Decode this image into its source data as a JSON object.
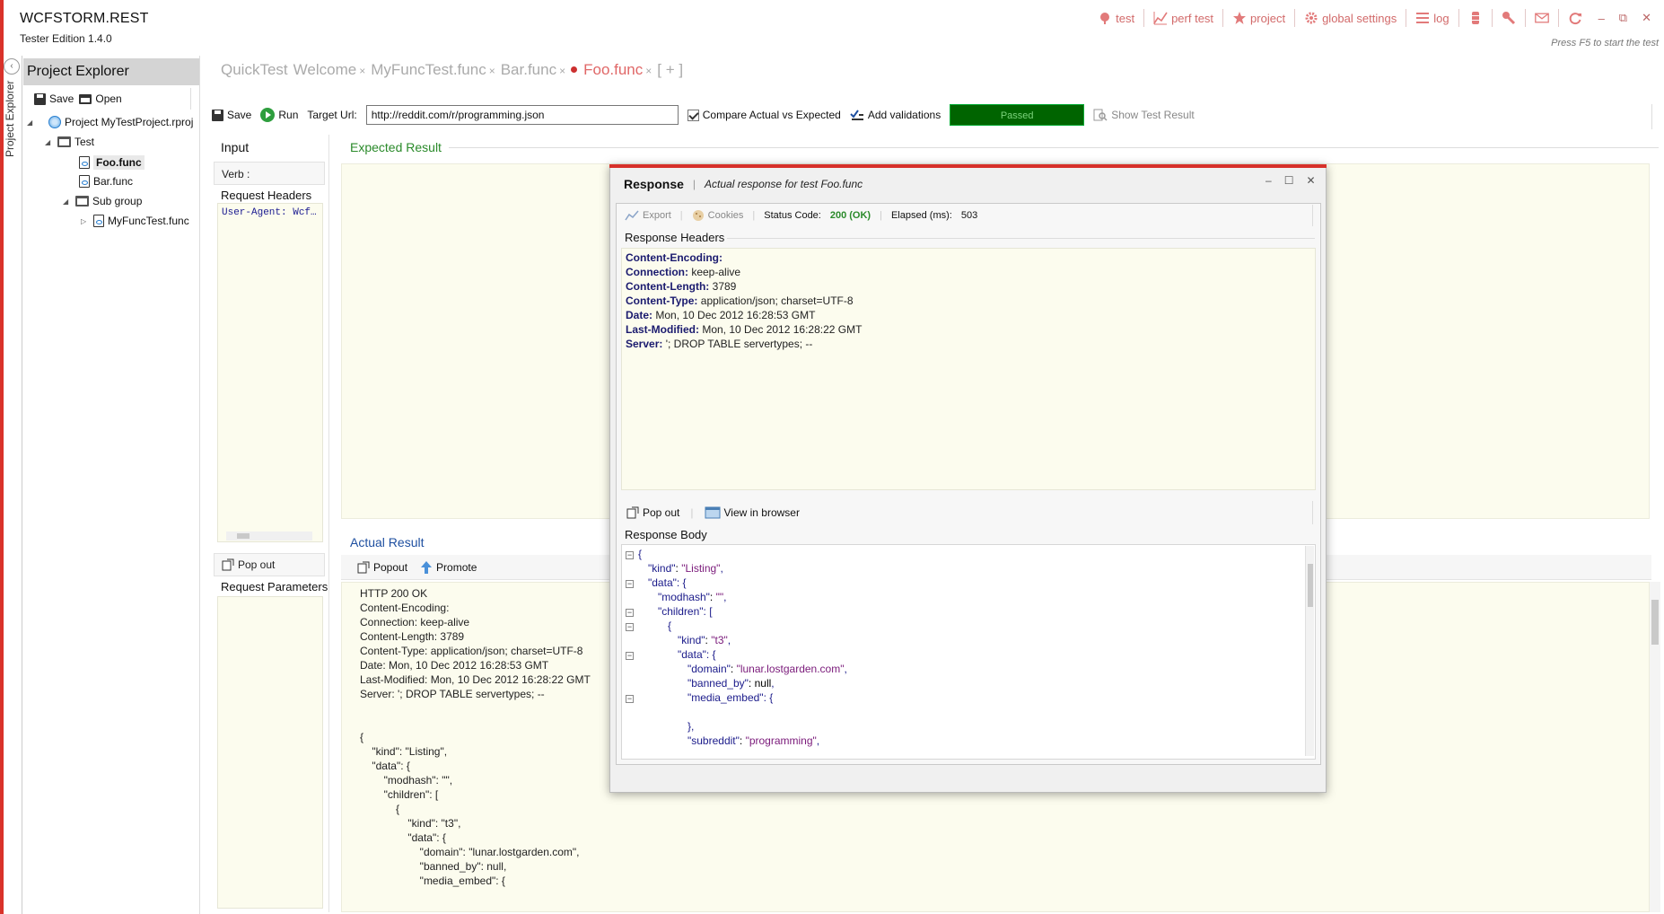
{
  "app": {
    "title": "WCFSTORM.REST",
    "subtitle": "Tester Edition 1.4.0",
    "hint": "Press F5 to start the test"
  },
  "topnav": {
    "items": [
      {
        "label": "test",
        "icon": "test-icon"
      },
      {
        "label": "perf test",
        "icon": "chart-icon"
      },
      {
        "label": "project",
        "icon": "star-icon"
      },
      {
        "label": "global settings",
        "icon": "gear-icon"
      },
      {
        "label": "log",
        "icon": "list-icon"
      }
    ],
    "window_controls": {
      "minimize": "–",
      "restore": "⧉",
      "close": "✕"
    }
  },
  "sidebar": {
    "vertical_tab": "Project Explorer",
    "header": "Project Explorer",
    "save": "Save",
    "open": "Open",
    "tree": {
      "project": "Project MyTestProject.rproj",
      "test_group": "Test",
      "foo": "Foo.func",
      "bar": "Bar.func",
      "sub_group": "Sub group",
      "myfunc": "MyFuncTest.func"
    }
  },
  "tabs": {
    "quicktest": "QuickTest",
    "welcome": "Welcome",
    "myfunctest": "MyFuncTest.func",
    "bar": "Bar.func",
    "foo": "Foo.func",
    "add": "[ + ]",
    "close": "×"
  },
  "toolbar": {
    "save": "Save",
    "run": "Run",
    "target_url_label": "Target Url:",
    "target_url_value": "http://reddit.com/r/programming.json",
    "compare": "Compare Actual vs Expected",
    "add_validations": "Add validations",
    "status": "Passed",
    "show_result": "Show Test Result"
  },
  "input": {
    "title": "Input",
    "verb_label": "Verb :",
    "request_headers": "Request Headers",
    "header_line": "User-Agent: Wcf…",
    "popout": "Pop out",
    "request_parameters": "Request Parameters"
  },
  "expected": {
    "title": "Expected Result"
  },
  "actual": {
    "title": "Actual Result",
    "popout": "Popout",
    "promote": "Promote",
    "lines": [
      "HTTP 200 OK",
      "Content-Encoding:",
      "Connection: keep-alive",
      "Content-Length: 3789",
      "Content-Type: application/json; charset=UTF-8",
      "Date: Mon, 10 Dec 2012 16:28:53 GMT",
      "Last-Modified: Mon, 10 Dec 2012 16:28:22 GMT",
      "Server: '; DROP TABLE servertypes; --",
      "",
      "",
      "{",
      "    \"kind\": \"Listing\",",
      "    \"data\": {",
      "        \"modhash\": \"\",",
      "        \"children\": [",
      "            {",
      "                \"kind\": \"t3\",",
      "                \"data\": {",
      "                    \"domain\": \"lunar.lostgarden.com\",",
      "                    \"banned_by\": null,",
      "                    \"media_embed\": {"
    ]
  },
  "response": {
    "title": "Response",
    "subtitle": "Actual response for test Foo.func",
    "export": "Export",
    "cookies": "Cookies",
    "status_code_label": "Status Code:",
    "status_code_value": "200 (OK)",
    "elapsed_label": "Elapsed (ms):",
    "elapsed_value": "503",
    "headers_title": "Response Headers",
    "headers": [
      {
        "name": "Content-Encoding:",
        "value": ""
      },
      {
        "name": "Connection:",
        "value": " keep-alive"
      },
      {
        "name": "Content-Length:",
        "value": " 3789"
      },
      {
        "name": "Content-Type:",
        "value": " application/json; charset=UTF-8"
      },
      {
        "name": "Date:",
        "value": " Mon, 10 Dec 2012 16:28:53 GMT"
      },
      {
        "name": "Last-Modified:",
        "value": " Mon, 10 Dec 2012 16:28:22 GMT"
      },
      {
        "name": "Server:",
        "value": " '; DROP TABLE servertypes; --"
      }
    ],
    "popout": "Pop out",
    "view_in_browser": "View in browser",
    "body_title": "Response Body",
    "body_lines": [
      {
        "indent": 0,
        "text": "{",
        "fold": true
      },
      {
        "indent": 1,
        "key": "\"kind\"",
        "value": "\"Listing\"",
        "tail": ","
      },
      {
        "indent": 1,
        "key": "\"data\"",
        "tail": ": {",
        "fold": true
      },
      {
        "indent": 2,
        "key": "\"modhash\"",
        "value": "\"\"",
        "tail": ","
      },
      {
        "indent": 2,
        "key": "\"children\"",
        "tail": ": [",
        "fold": true
      },
      {
        "indent": 3,
        "text": "{",
        "fold": true
      },
      {
        "indent": 4,
        "key": "\"kind\"",
        "value": "\"t3\"",
        "tail": ","
      },
      {
        "indent": 4,
        "key": "\"data\"",
        "tail": ": {",
        "fold": true
      },
      {
        "indent": 5,
        "key": "\"domain\"",
        "value": "\"lunar.lostgarden.com\"",
        "tail": ","
      },
      {
        "indent": 5,
        "key": "\"banned_by\"",
        "value": "null",
        "tail": ","
      },
      {
        "indent": 5,
        "key": "\"media_embed\"",
        "tail": ": {",
        "fold": true
      },
      {
        "indent": 5,
        "text": ""
      },
      {
        "indent": 5,
        "text": "},"
      },
      {
        "indent": 5,
        "key": "\"subreddit\"",
        "value": "\"programming\"",
        "tail": ","
      }
    ]
  }
}
